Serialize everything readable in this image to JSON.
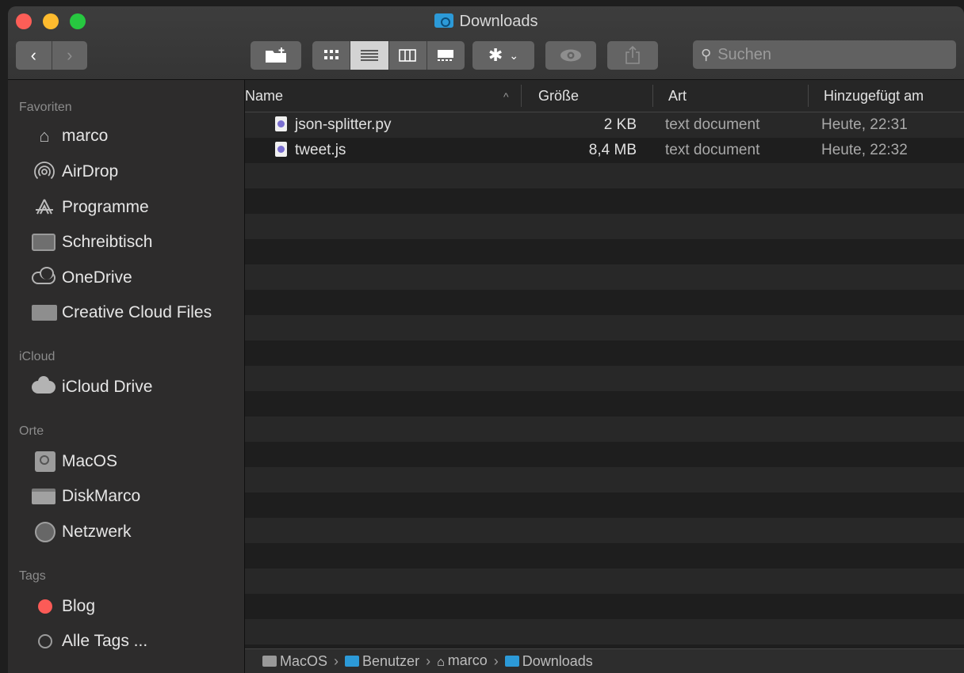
{
  "window": {
    "title": "Downloads"
  },
  "toolbar": {
    "back_icon": "chevron-left-icon",
    "forward_icon": "chevron-right-icon",
    "search_placeholder": "Suchen"
  },
  "sidebar": {
    "sections": {
      "favorites": "Favoriten",
      "icloud": "iCloud",
      "places": "Orte",
      "tags": "Tags"
    },
    "favorites": [
      {
        "label": "marco",
        "icon": "home-icon"
      },
      {
        "label": "AirDrop",
        "icon": "airdrop-icon"
      },
      {
        "label": "Programme",
        "icon": "applications-icon"
      },
      {
        "label": "Schreibtisch",
        "icon": "desktop-icon"
      },
      {
        "label": "OneDrive",
        "icon": "cloud-icon"
      },
      {
        "label": "Creative Cloud Files",
        "icon": "folder-icon"
      }
    ],
    "icloud": [
      {
        "label": "iCloud Drive",
        "icon": "cloud-icon"
      }
    ],
    "places": [
      {
        "label": "MacOS",
        "icon": "disk-icon"
      },
      {
        "label": "DiskMarco",
        "icon": "nas-icon"
      },
      {
        "label": "Netzwerk",
        "icon": "network-icon"
      }
    ],
    "tags": [
      {
        "label": "Blog",
        "color": "#fc5b57"
      },
      {
        "label": "Alle Tags ...",
        "color": "#9b9b9b"
      }
    ]
  },
  "list": {
    "columns": {
      "name": "Name",
      "size": "Größe",
      "kind": "Art",
      "date": "Hinzugefügt am"
    },
    "files": [
      {
        "name": "json-splitter.py",
        "size": "2 KB",
        "kind": "text document",
        "date": "Heute, 22:31"
      },
      {
        "name": "tweet.js",
        "size": "8,4 MB",
        "kind": "text document",
        "date": "Heute, 22:32"
      }
    ]
  },
  "pathbar": {
    "items": [
      "MacOS",
      "Benutzer",
      "marco",
      "Downloads"
    ],
    "separator": "›"
  }
}
